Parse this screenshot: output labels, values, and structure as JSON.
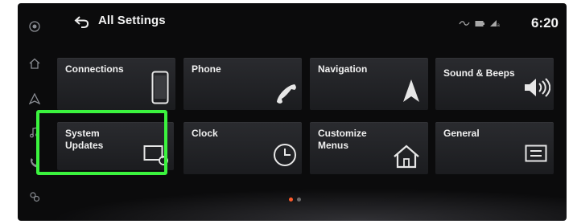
{
  "header": {
    "title": "All Settings",
    "time": "6:20"
  },
  "sidebar": {
    "icons": [
      "audio-source-icon",
      "home-icon",
      "navigation-icon",
      "music-icon",
      "phone-icon",
      "apps-icon"
    ]
  },
  "tiles": [
    {
      "label": "Connections",
      "icon": "smartphone-icon"
    },
    {
      "label": "Phone",
      "icon": "phone-handset-icon"
    },
    {
      "label": "Navigation",
      "icon": "navigation-arrow-icon"
    },
    {
      "label": "Sound & Beeps",
      "icon": "speaker-icon"
    },
    {
      "label": "System\nUpdates",
      "icon": "system-update-icon"
    },
    {
      "label": "Clock",
      "icon": "clock-icon"
    },
    {
      "label": "Customize\nMenus",
      "icon": "house-icon"
    },
    {
      "label": "General",
      "icon": "general-settings-icon"
    }
  ],
  "pager": {
    "pages": 2,
    "current": 1
  },
  "colors": {
    "highlight": "#3bf33e",
    "page_active": "#ff5a2a",
    "page_inactive": "#6a6a6a"
  }
}
